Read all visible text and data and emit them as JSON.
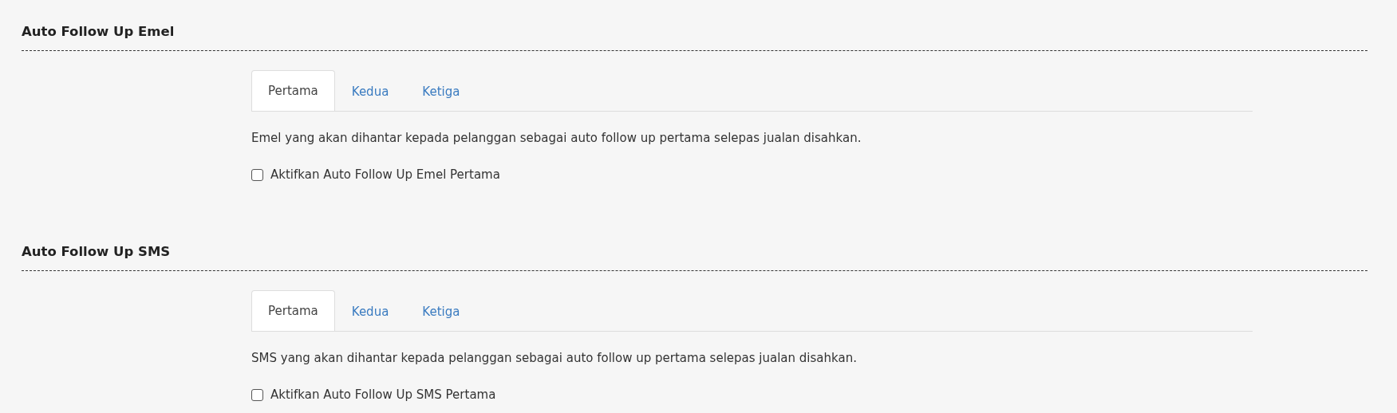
{
  "sections": [
    {
      "title": "Auto Follow Up Emel",
      "tabs": [
        {
          "label": "Pertama",
          "selected": true
        },
        {
          "label": "Kedua",
          "selected": false
        },
        {
          "label": "Ketiga",
          "selected": false
        }
      ],
      "description": "Emel yang akan dihantar kepada pelanggan sebagai auto follow up pertama selepas jualan disahkan.",
      "checkbox": {
        "label": "Aktifkan Auto Follow Up Emel Pertama",
        "checked": false
      }
    },
    {
      "title": "Auto Follow Up SMS",
      "tabs": [
        {
          "label": "Pertama",
          "selected": true
        },
        {
          "label": "Kedua",
          "selected": false
        },
        {
          "label": "Ketiga",
          "selected": false
        }
      ],
      "description": "SMS yang akan dihantar kepada pelanggan sebagai auto follow up pertama selepas jualan disahkan.",
      "checkbox": {
        "label": "Aktifkan Auto Follow Up SMS Pertama",
        "checked": false
      }
    }
  ]
}
